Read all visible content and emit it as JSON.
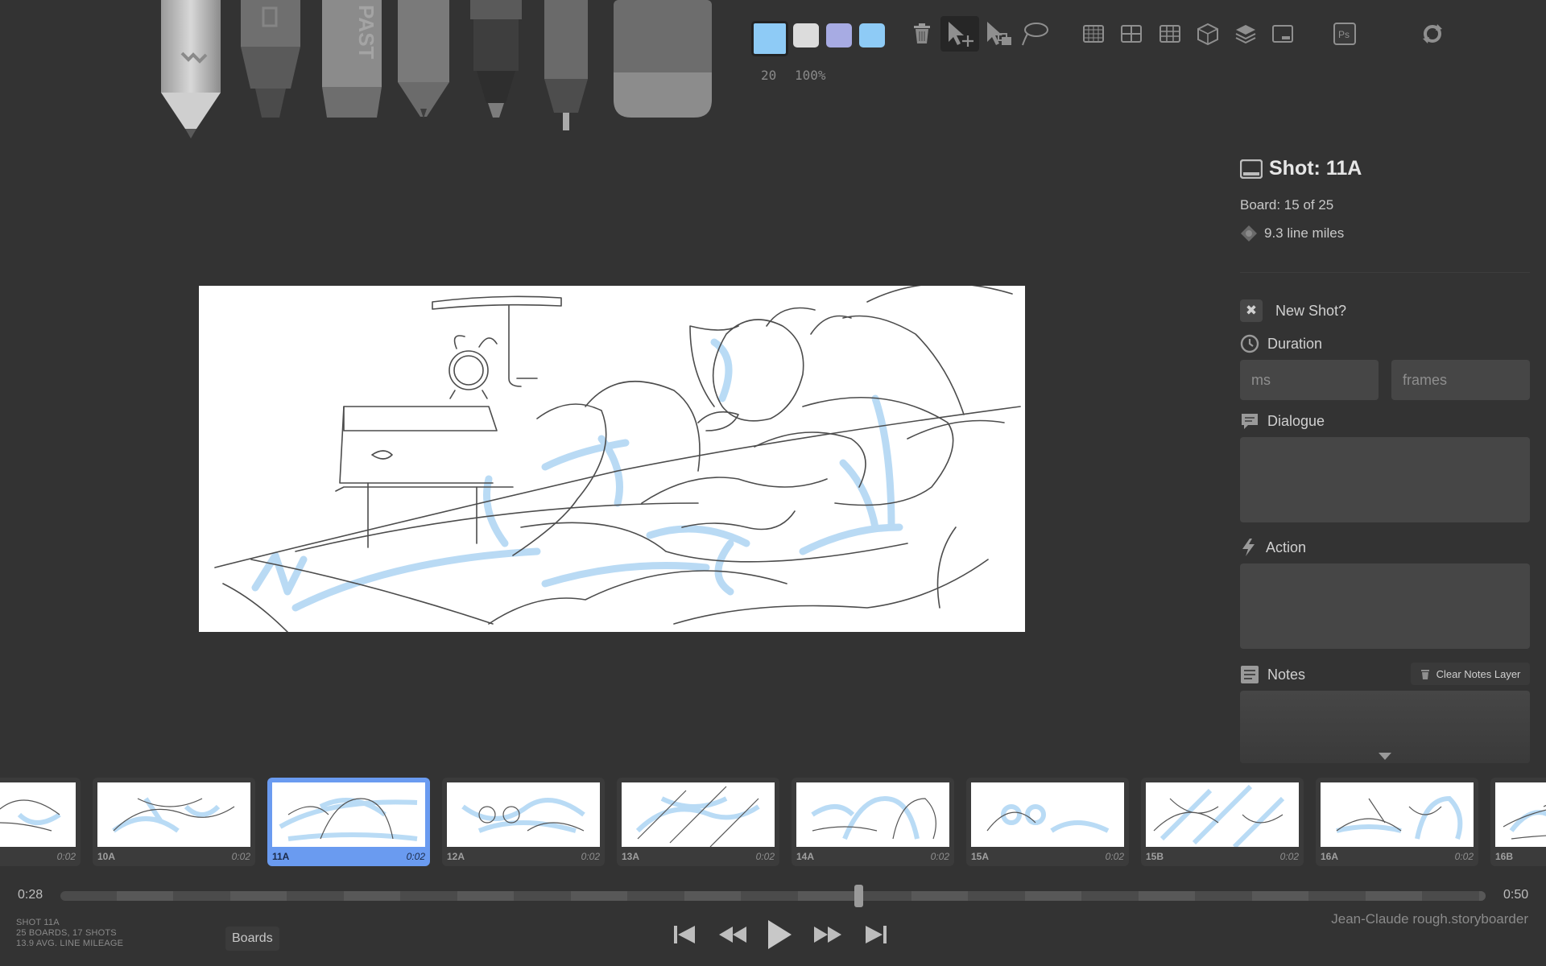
{
  "toolbar": {
    "brush_size": "20",
    "opacity": "100%",
    "swatches": [
      {
        "name": "light-blue",
        "color": "#8ecbf6"
      },
      {
        "name": "light-gray",
        "color": "#dcdcdc"
      },
      {
        "name": "lavender",
        "color": "#a7abe3"
      },
      {
        "name": "sky-blue",
        "color": "#8ecbf6"
      }
    ],
    "tools": [
      "pencil-tool",
      "marker-tool",
      "pastel-tool",
      "pen-tool",
      "brush-pen-tool",
      "liner-tool",
      "eraser-tool"
    ],
    "tool_text": {
      "pastel": "PAST"
    },
    "ps_label": "Ps"
  },
  "panel": {
    "shot_title": "Shot: 11A",
    "board_position": "Board: 15 of 25",
    "line_miles": "9.3 line miles",
    "new_shot_label": "New Shot?",
    "duration_label": "Duration",
    "ms_placeholder": "ms",
    "frames_placeholder": "frames",
    "dialogue_label": "Dialogue",
    "action_label": "Action",
    "notes_label": "Notes",
    "clear_notes_label": "Clear Notes Layer"
  },
  "thumbnails": [
    {
      "label": "",
      "time": "0:02",
      "selected": false
    },
    {
      "label": "10A",
      "time": "0:02",
      "selected": false
    },
    {
      "label": "11A",
      "time": "0:02",
      "selected": true
    },
    {
      "label": "12A",
      "time": "0:02",
      "selected": false
    },
    {
      "label": "13A",
      "time": "0:02",
      "selected": false
    },
    {
      "label": "14A",
      "time": "0:02",
      "selected": false
    },
    {
      "label": "15A",
      "time": "0:02",
      "selected": false
    },
    {
      "label": "15B",
      "time": "0:02",
      "selected": false
    },
    {
      "label": "16A",
      "time": "0:02",
      "selected": false
    },
    {
      "label": "16B",
      "time": "",
      "selected": false
    }
  ],
  "timeline": {
    "current_time": "0:28",
    "total_time": "0:50",
    "playhead_fraction": 0.56
  },
  "status": {
    "shot": "SHOT 11A",
    "counts": "25 BOARDS, 17 SHOTS",
    "mileage": "13.9 AVG. LINE MILEAGE"
  },
  "boards_button": "Boards",
  "filename": "Jean-Claude rough.storyboarder"
}
